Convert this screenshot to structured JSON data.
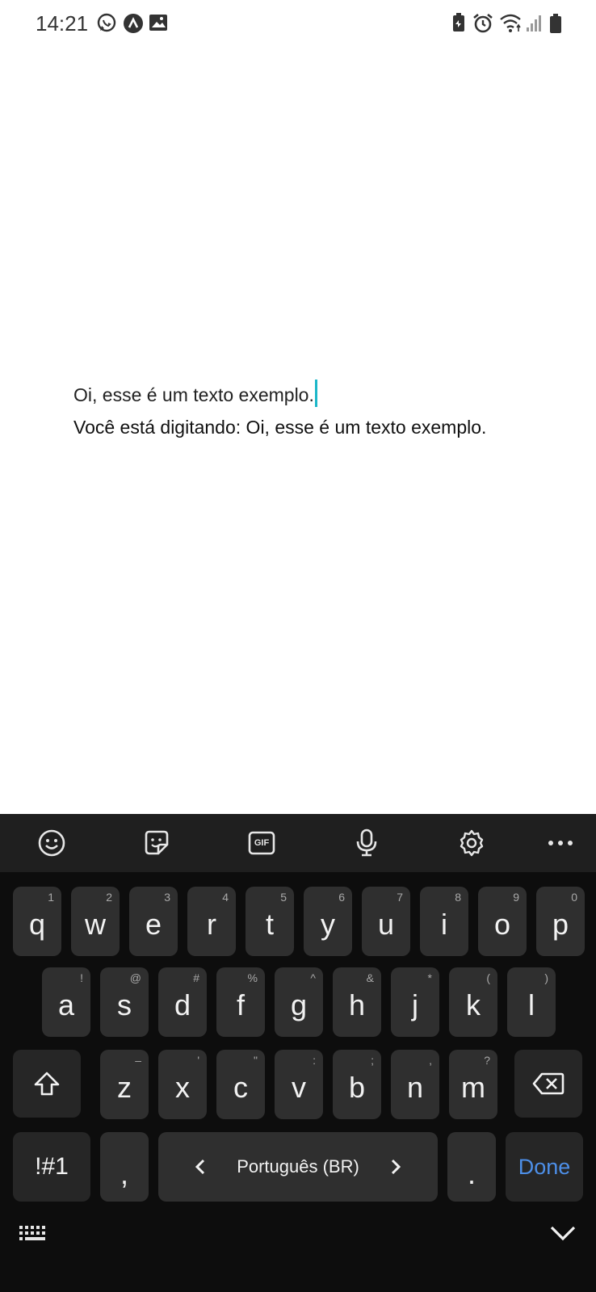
{
  "status_bar": {
    "time": "14:21",
    "left_icons": [
      "whatsapp-icon",
      "app-notification-icon",
      "gallery-icon"
    ],
    "right_icons": [
      "battery-saver-icon",
      "alarm-icon",
      "wifi-icon",
      "signal-icon",
      "battery-icon"
    ]
  },
  "content": {
    "input_text": "Oi, esse é um texto exemplo.",
    "echo_text": "Você está digitando: Oi, esse é um texto exemplo."
  },
  "keyboard": {
    "toolbar": [
      "emoji-icon",
      "sticker-icon",
      "gif-icon",
      "microphone-icon",
      "settings-icon",
      "more-icon"
    ],
    "gif_label": "GIF",
    "row1": [
      {
        "key": "q",
        "hint": "1"
      },
      {
        "key": "w",
        "hint": "2"
      },
      {
        "key": "e",
        "hint": "3"
      },
      {
        "key": "r",
        "hint": "4"
      },
      {
        "key": "t",
        "hint": "5"
      },
      {
        "key": "y",
        "hint": "6"
      },
      {
        "key": "u",
        "hint": "7"
      },
      {
        "key": "i",
        "hint": "8"
      },
      {
        "key": "o",
        "hint": "9"
      },
      {
        "key": "p",
        "hint": "0"
      }
    ],
    "row2": [
      {
        "key": "a",
        "hint": "!"
      },
      {
        "key": "s",
        "hint": "@"
      },
      {
        "key": "d",
        "hint": "#"
      },
      {
        "key": "f",
        "hint": "%"
      },
      {
        "key": "g",
        "hint": "^"
      },
      {
        "key": "h",
        "hint": "&"
      },
      {
        "key": "j",
        "hint": "*"
      },
      {
        "key": "k",
        "hint": "("
      },
      {
        "key": "l",
        "hint": ")"
      }
    ],
    "row3": [
      {
        "key": "z",
        "hint": "–"
      },
      {
        "key": "x",
        "hint": "'"
      },
      {
        "key": "c",
        "hint": "\""
      },
      {
        "key": "v",
        "hint": ":"
      },
      {
        "key": "b",
        "hint": ";"
      },
      {
        "key": "n",
        "hint": ","
      },
      {
        "key": "m",
        "hint": "?"
      }
    ],
    "symbols_label": "!#1",
    "comma_label": ",",
    "language_label": "Português (BR)",
    "period_label": ".",
    "done_label": "Done",
    "accent_color": "#4d8fe8"
  }
}
